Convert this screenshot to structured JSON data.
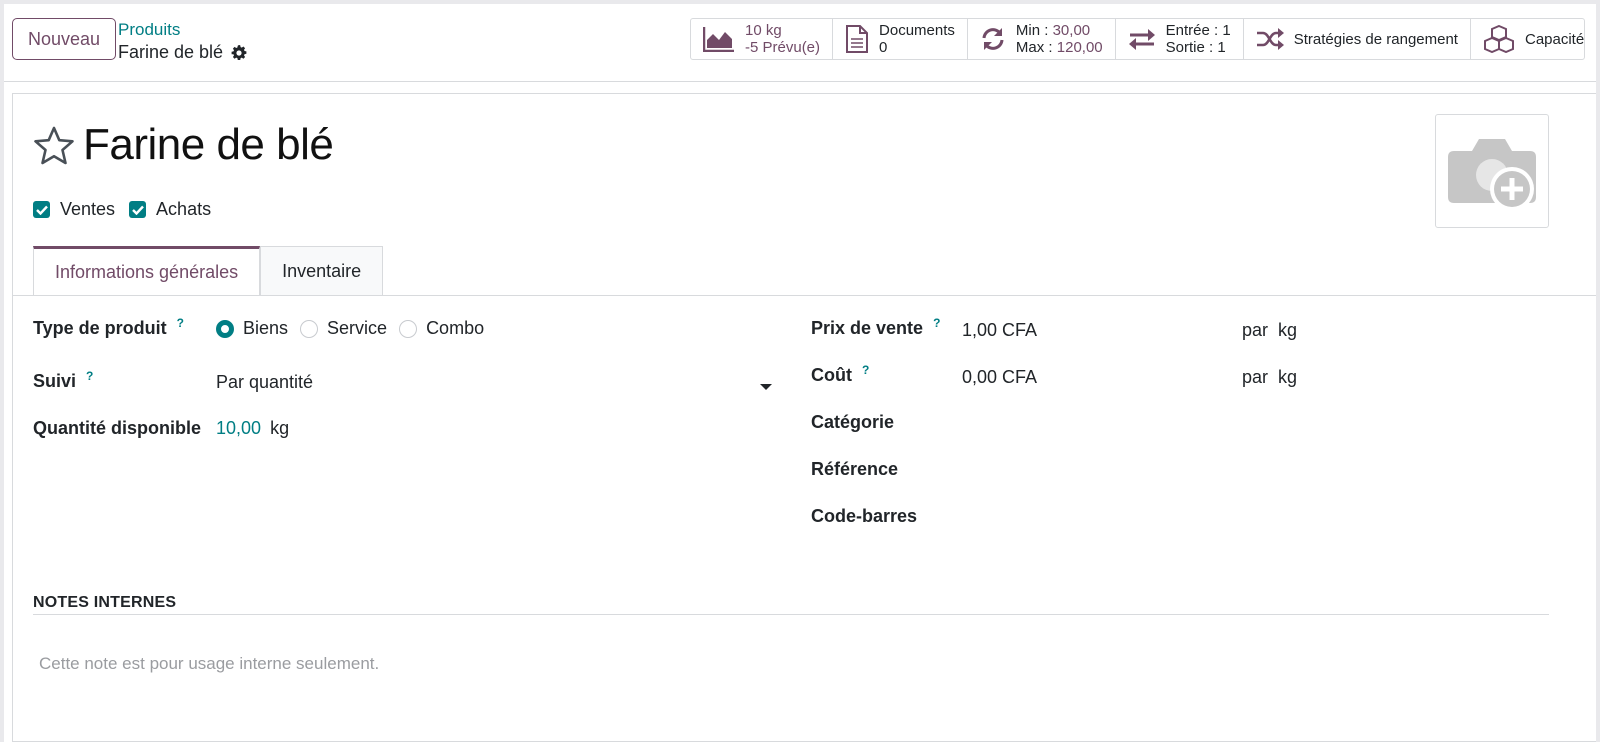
{
  "control_panel": {
    "new_button": "Nouveau",
    "breadcrumb": "Produits",
    "record_title": "Farine de blé"
  },
  "smart_buttons": [
    {
      "icon": "area-chart-icon",
      "line1": "10 kg",
      "line2": "-5 Prévu(e)"
    },
    {
      "icon": "document-icon",
      "line1": "Documents",
      "line2": "0"
    },
    {
      "icon": "refresh-icon",
      "line1_label": "Min :",
      "line1_value": "30,00",
      "line2_label": "Max :",
      "line2_value": "120,00"
    },
    {
      "icon": "exchange-icon",
      "line1": "Entrée : 1",
      "line2": "Sortie : 1"
    },
    {
      "icon": "random-icon",
      "line1": "Stratégies de rangement"
    },
    {
      "icon": "cubes-icon",
      "line1": "Capacité"
    }
  ],
  "product": {
    "name": "Farine de blé",
    "checkboxes": [
      {
        "label": "Ventes",
        "checked": true
      },
      {
        "label": "Achats",
        "checked": true
      }
    ]
  },
  "tabs": [
    {
      "label": "Informations générales",
      "active": true
    },
    {
      "label": "Inventaire",
      "active": false
    }
  ],
  "left_fields": {
    "product_type": {
      "label": "Type de produit",
      "help": "?",
      "options": [
        {
          "label": "Biens",
          "selected": true
        },
        {
          "label": "Service",
          "selected": false
        },
        {
          "label": "Combo",
          "selected": false
        }
      ]
    },
    "tracking": {
      "label": "Suivi",
      "help": "?",
      "value": "Par quantité"
    },
    "qty": {
      "label": "Quantité disponible",
      "value": "10,00",
      "unit": "kg"
    }
  },
  "right_fields": {
    "sale_price": {
      "label": "Prix de vente",
      "help": "?",
      "value": "1,00 CFA",
      "per": "par",
      "unit": "kg"
    },
    "cost": {
      "label": "Coût",
      "help": "?",
      "value": "0,00 CFA",
      "per": "par",
      "unit": "kg"
    },
    "category": {
      "label": "Catégorie"
    },
    "reference": {
      "label": "Référence"
    },
    "barcode": {
      "label": "Code-barres"
    }
  },
  "notes": {
    "title": "NOTES INTERNES",
    "placeholder": "Cette note est pour usage interne seulement."
  },
  "colors": {
    "primary": "#714b67",
    "teal": "#017e84",
    "border": "#d8dadd"
  }
}
